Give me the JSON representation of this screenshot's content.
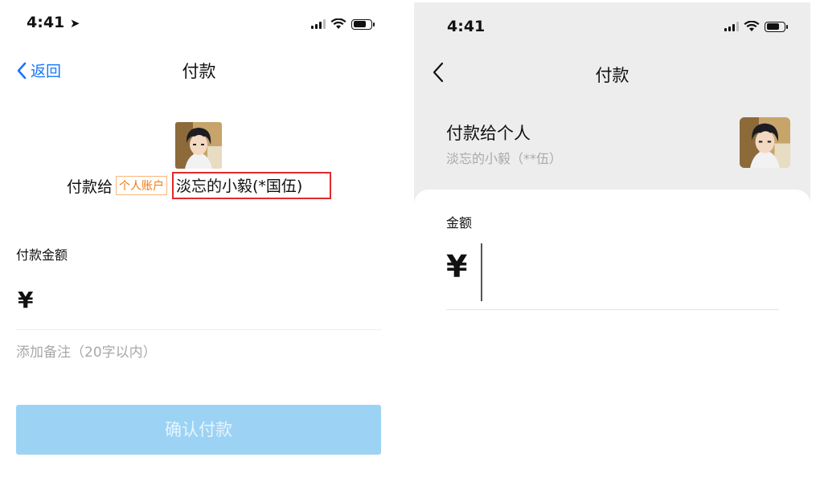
{
  "left_screen": {
    "status_time": "4:41",
    "nav": {
      "back_label": "返回",
      "title": "付款"
    },
    "payee": {
      "prefix": "付款给",
      "account_tag": "个人账户",
      "name": "淡忘的小毅(*国伍)"
    },
    "amount_label": "付款金额",
    "currency_symbol": "¥",
    "note_placeholder": "添加备注（20字以内）",
    "confirm_button": "确认付款",
    "colors": {
      "link": "#1677ff",
      "tag": "#f07a10",
      "highlight_box": "#e22a2a",
      "button_disabled": "#9cd3f4"
    }
  },
  "right_screen": {
    "status_time": "4:41",
    "nav": {
      "title": "付款"
    },
    "pay_to_title": "付款给个人",
    "payee_subtitle": "淡忘的小毅（**伍）",
    "amount_label": "金额",
    "currency_symbol": "¥",
    "colors": {
      "background": "#ededed"
    }
  }
}
